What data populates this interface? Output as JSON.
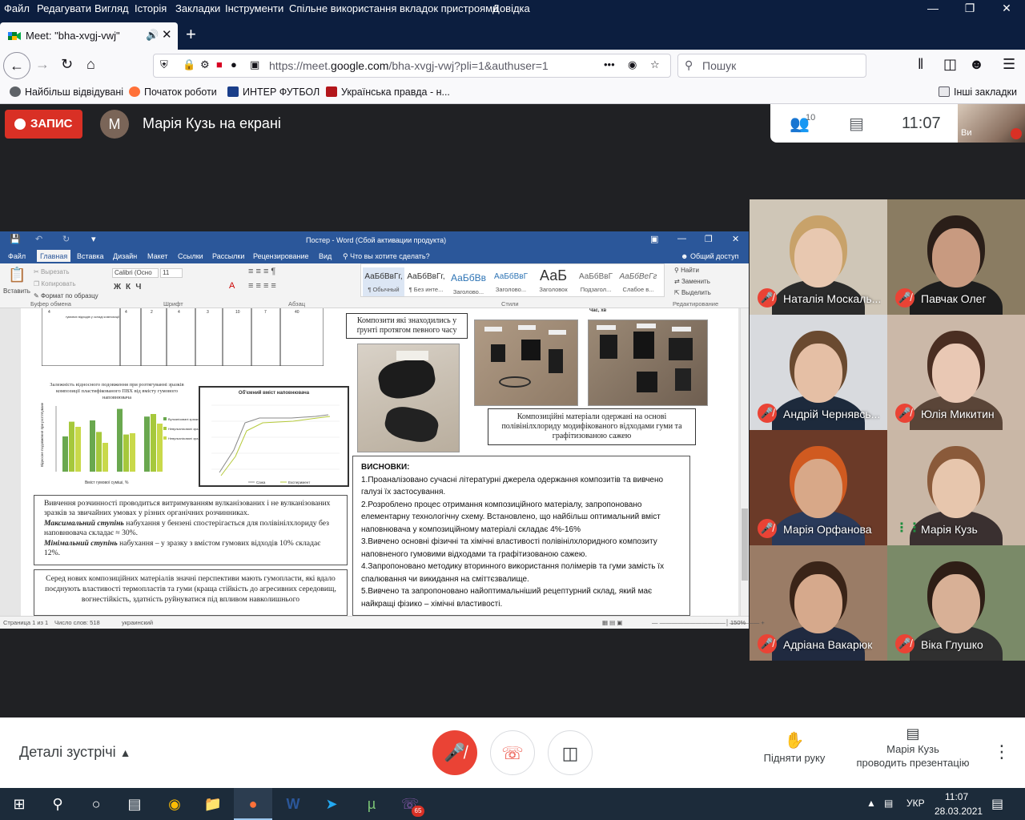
{
  "browser": {
    "menu": [
      "Файл",
      "Редагувати",
      "Вигляд",
      "Історія",
      "Закладки",
      "Інструменти",
      "Спільне використання вкладок пристроями",
      "Довідка"
    ],
    "tab_title": "Meet: \"bha-xvgj-vwj\"",
    "url_prefix": "https://meet.",
    "url_host": "google.com",
    "url_rest": "/bha-xvgj-vwj?pli=1&authuser=1",
    "search_placeholder": "Пошук",
    "bookmarks": [
      {
        "label": "Найбільш відвідувані",
        "color": "#5f6368"
      },
      {
        "label": "Початок роботи",
        "color": "#ff7139"
      },
      {
        "label": "ИНТЕР ФУТБОЛ",
        "color": "#1a3e8a"
      },
      {
        "label": "Українська правда - н...",
        "color": "#b3161b"
      }
    ],
    "other_bookmarks": "Інші закладки"
  },
  "meet": {
    "record_label": "ЗАПИС",
    "presenter_initial": "M",
    "presenting_text": "Марія Кузь на екрані",
    "participants_count": "10",
    "time": "11:07",
    "self_label": "Ви",
    "participants": [
      {
        "name": "Наталія Москаль...",
        "mic": "muted",
        "bg": "#cfc6b7",
        "skin": "#e8c8b0",
        "hair": "#c8a26a",
        "cloth": "#2b2b2b"
      },
      {
        "name": "Павчак Олег",
        "mic": "muted",
        "bg": "#8a7c62",
        "skin": "#c89a80",
        "hair": "#2a1e18",
        "cloth": "#1e1e1e"
      },
      {
        "name": "Андрій Чернявсь...",
        "mic": "muted",
        "bg": "#d8dade",
        "skin": "#e5bfa5",
        "hair": "#6a4a30",
        "cloth": "#1d2a3c"
      },
      {
        "name": "Юлія Микитин",
        "mic": "muted",
        "bg": "#cbb8a8",
        "skin": "#e9c8b4",
        "hair": "#4a2e22",
        "cloth": "#5a4538"
      },
      {
        "name": "Марія Орфанова",
        "mic": "muted",
        "bg": "#6b3a28",
        "skin": "#d8a888",
        "hair": "#d05a20",
        "cloth": "#2a3a5a"
      },
      {
        "name": "Марія Кузь",
        "mic": "speaking",
        "bg": "#c9b7a6",
        "skin": "#e7c6ad",
        "hair": "#8a5a3a",
        "cloth": "#3a3030"
      },
      {
        "name": "Адріана Вакарюк",
        "mic": "muted",
        "bg": "#9a7c66",
        "skin": "#d6a98c",
        "hair": "#3a2418",
        "cloth": "#202a40"
      },
      {
        "name": "Віка Глушко",
        "mic": "muted",
        "bg": "#7a8a68",
        "skin": "#d8b096",
        "hair": "#2e1e16",
        "cloth": "#303030"
      }
    ],
    "bottom": {
      "details": "Деталі зустрічі",
      "raise_hand": "Підняти руку",
      "presenting_line1": "Марія Кузь",
      "presenting_line2": "проводить презентацію"
    }
  },
  "word": {
    "title": "Постер - Word (Сбой активации продукта)",
    "tabs": [
      "Файл",
      "Главная",
      "Вставка",
      "Дизайн",
      "Макет",
      "Ссылки",
      "Рассылки",
      "Рецензирование",
      "Вид",
      "Что вы хотите сделать?"
    ],
    "share": "Общий доступ",
    "clipboard": [
      "Вставить",
      "Вырезать",
      "Копировать",
      "Формат по образцу"
    ],
    "font_name": "Calibri (Осно",
    "font_size": "11",
    "styles": [
      {
        "preview": "АаБбВвГг,",
        "name": "¶ Обычный"
      },
      {
        "preview": "АаБбВвГг,",
        "name": "¶ Без инте..."
      },
      {
        "preview": "АаБбВв",
        "name": "Заголово..."
      },
      {
        "preview": "АаБбВвГ",
        "name": "Заголово..."
      },
      {
        "preview": "АаБ",
        "name": "Заголовок"
      },
      {
        "preview": "АаБбВвГ",
        "name": "Подзагол..."
      },
      {
        "preview": "АаБбВеГг",
        "name": "Слабое в..."
      }
    ],
    "groups": [
      "Буфер обмена",
      "Шрифт",
      "Абзац",
      "Стили",
      "Редактирование"
    ],
    "editing": [
      "Найти",
      "Заменить",
      "Выделить"
    ],
    "status": {
      "page": "Страница 1 из 1",
      "words": "Число слов: 518",
      "lang": "украинский",
      "zoom": "150%"
    },
    "doc": {
      "table_cells": [
        "4",
        "4",
        "2",
        "4",
        "3",
        "10",
        "7",
        "40"
      ],
      "table_note": "гумових відходів у складі композиції",
      "chart1_title": "Залежність відносного подовження при розтягуванні зразків композиції пластифікованого ПВХ від вмісту гумового наповнювача",
      "chart1_ylabel": "Відносне подовження при розтягуванні (ε), %",
      "chart1_xlabel": "Вміст гумової суміші, %",
      "chart1_legend": [
        "Вулканізовані зразки",
        "Невулканізовані зразки",
        "Невулканізовані зразки 2"
      ],
      "chart2_title": "Об'ємний вміст наповнювача",
      "chart2_legend": [
        "Сажа",
        "Експеримент"
      ],
      "caption_time": "Час, хв",
      "caption_soil": "Композити які знаходились у ґрунті протягом певного часу",
      "caption_materials": "Композиційні матеріали одержані на основі полівінілхлориду модифікованого відходами гуми та графітизованою сажею",
      "study_text_1": "Вивчення розчинності проводиться витримуванням вулканізованих і не вулканізованих зразків за звичайних умовах у різних органічних розчинниках.",
      "study_max_label": "Максимальний ступінь",
      "study_max_text": "набухання у бензені спостерігається для полівінілхлориду без наповнювача складає ≈ 30%.",
      "study_min_label": "Мінімальний ступінь",
      "study_min_text": "набухання – у зразку з вмістом гумових відходів 10% складає 12%.",
      "perspective_text": "Серед нових композиційних матеріалів значні перспективи мають гумопласти, які вдало поєднують властивості термопластів та гуми (краща стійкість до агресивних середовищ, вогнестійкість, здатність руйнуватися під впливом навколишнього",
      "conclusions_title": "ВИСНОВКИ:",
      "conclusions": [
        "1.Проаналізовано сучасні літературні джерела одержання композитів та вивчено галузі їх застосування.",
        "2.Розроблено процес отримання композиційного матеріалу, запропоновано елементарну технологічну схему. Встановлено, що найбільш оптимальний вміст наповнювача у композиційному матеріалі складає 4%-16%",
        "3.Вивчено основні фізичні та хімічні властивості полівінілхлоридного композиту наповненого гумовими відходами та графітизованою сажею.",
        "4.Запропоновано методику вторинного використання полімерів та гуми замість їх спалювання чи викидання на сміттєзвалище.",
        "5.Вивчено та запропоновано найоптимальніший рецептурний склад, який має найкращі фізико – хімічні властивості."
      ]
    }
  },
  "taskbar": {
    "lang": "УКР",
    "time": "11:07",
    "date": "28.03.2021",
    "viber_badge": "65"
  }
}
